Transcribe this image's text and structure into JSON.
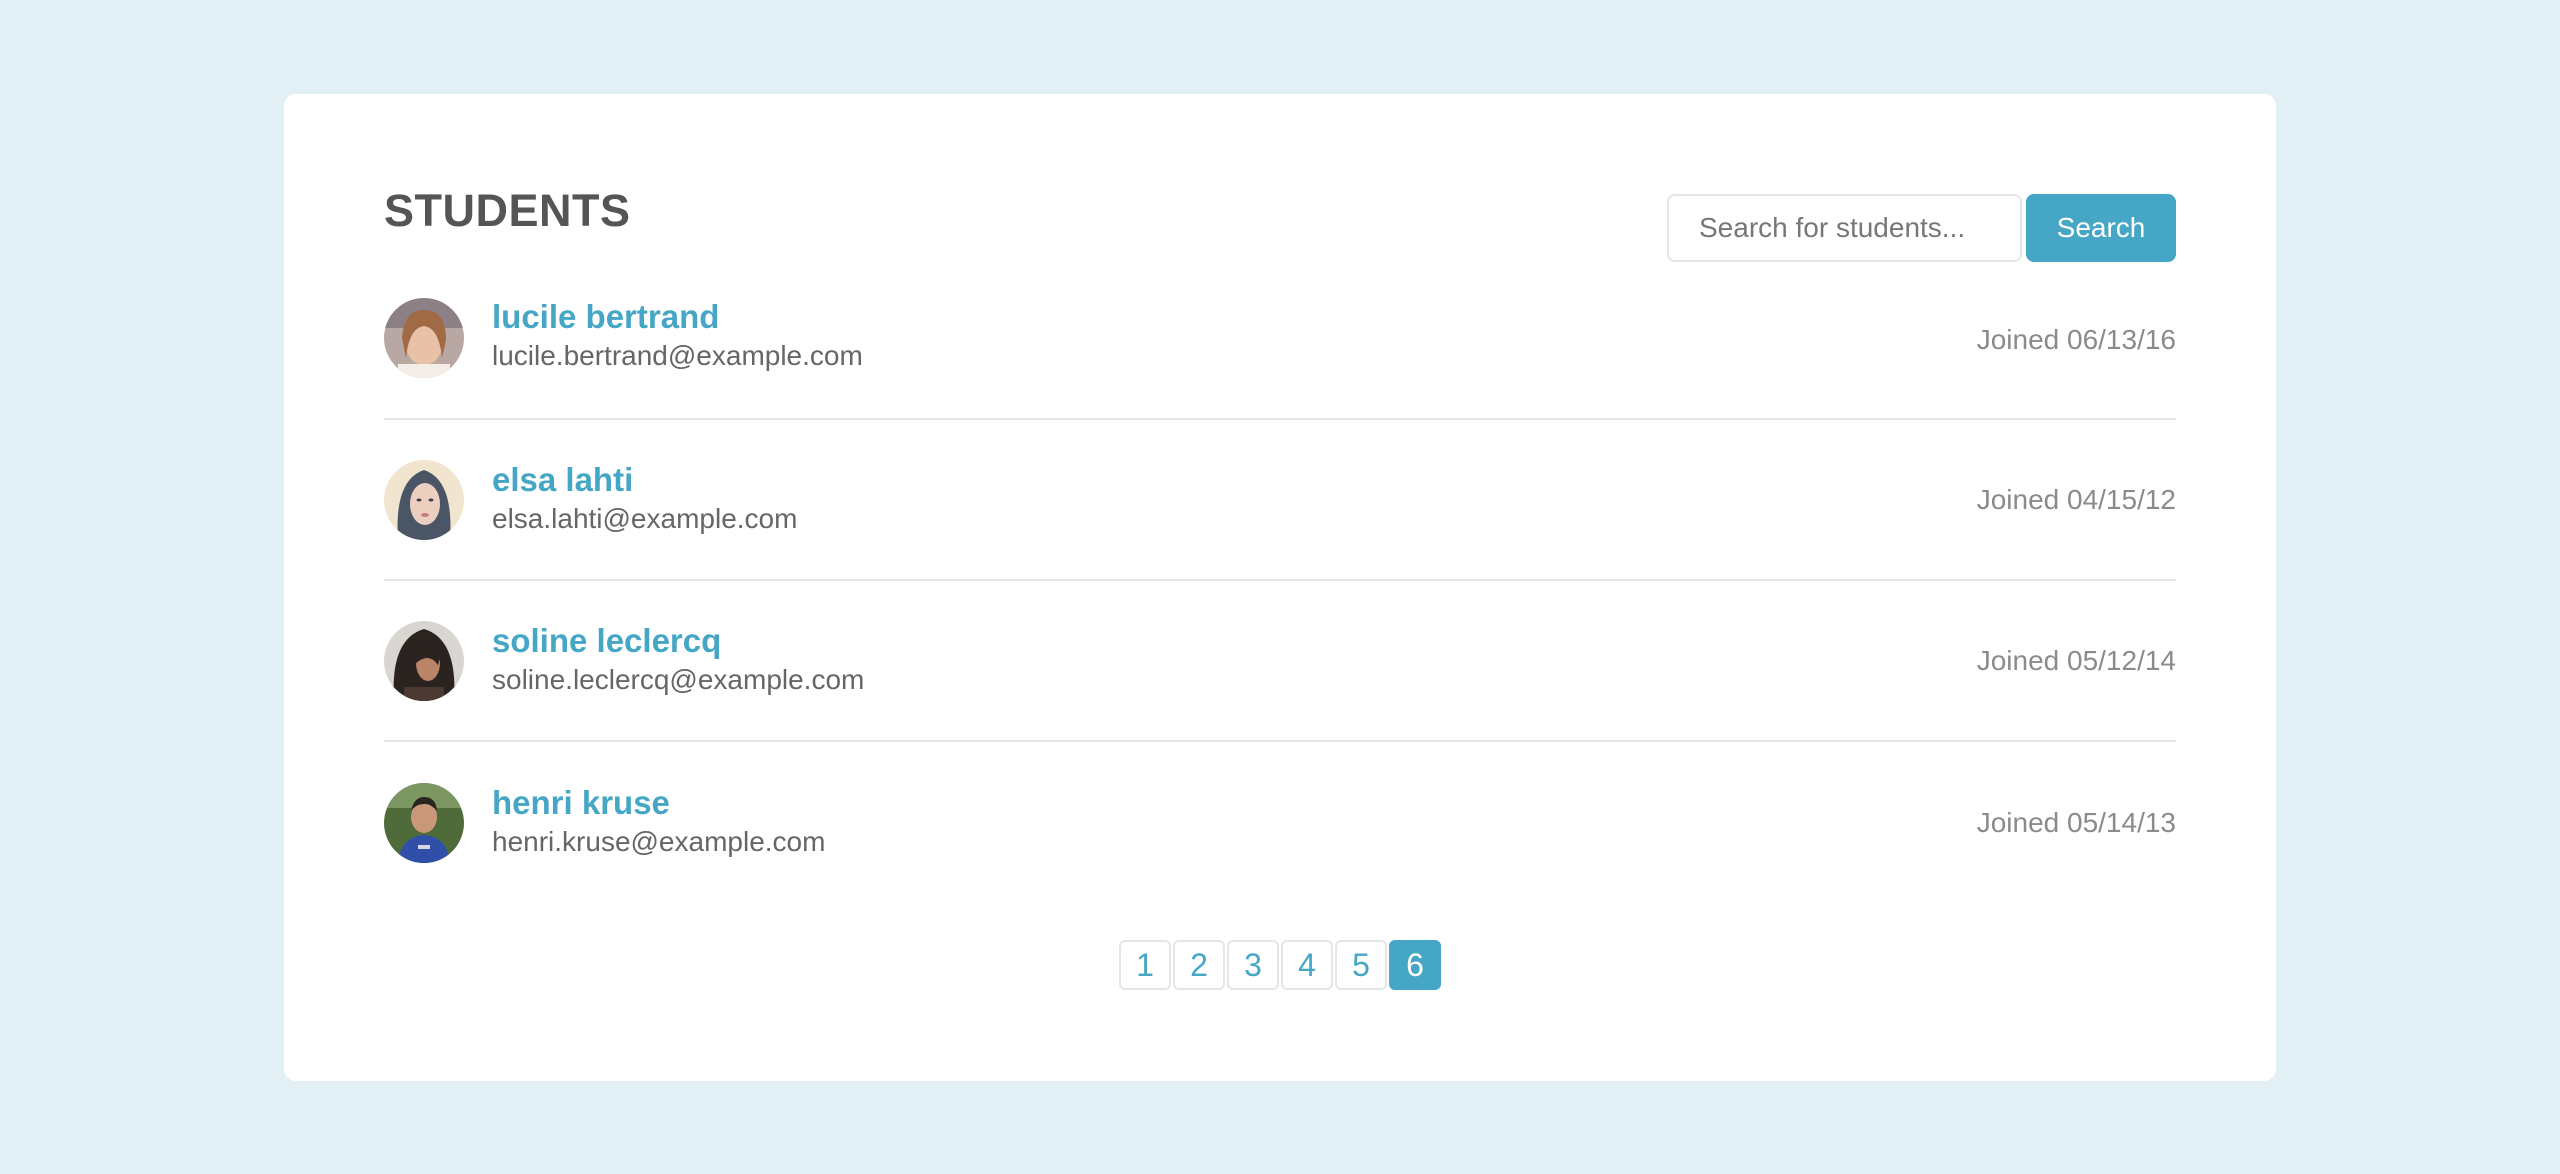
{
  "header": {
    "title": "STUDENTS"
  },
  "search": {
    "placeholder": "Search for students...",
    "value": "",
    "button_label": "Search"
  },
  "students": [
    {
      "name": "lucile bertrand",
      "email": "lucile.bertrand@example.com",
      "joined": "Joined 06/13/16"
    },
    {
      "name": "elsa lahti",
      "email": "elsa.lahti@example.com",
      "joined": "Joined 04/15/12"
    },
    {
      "name": "soline leclercq",
      "email": "soline.leclercq@example.com",
      "joined": "Joined 05/12/14"
    },
    {
      "name": "henri kruse",
      "email": "henri.kruse@example.com",
      "joined": "Joined 05/14/13"
    }
  ],
  "pagination": {
    "pages": [
      "1",
      "2",
      "3",
      "4",
      "5",
      "6"
    ],
    "current": "6"
  },
  "colors": {
    "background": "#e2f0f5",
    "accent": "#45a6c5",
    "heading": "#555555",
    "muted": "#8b8b8b"
  }
}
